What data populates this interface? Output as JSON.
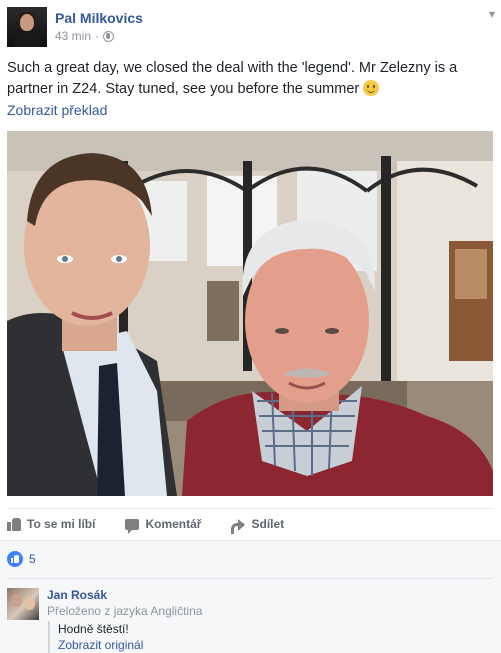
{
  "post": {
    "author": "Pal Milkovics",
    "time": "43 min",
    "separator": "·",
    "text": "Such a great day, we closed the deal with the 'legend'. Mr Zelezny is a partner in Z24. Stay tuned, see you before the summer",
    "emoji": "smile-emoji",
    "translate_link": "Zobrazit překlad"
  },
  "actions": {
    "like": "To se mi líbí",
    "comment": "Komentář",
    "share": "Sdílet"
  },
  "reactions": {
    "count": "5"
  },
  "comment": {
    "author": "Jan Rosák",
    "translation_note": "Přeloženo z jazyka Angličtina",
    "text": "Hodně štěstí!",
    "original_link": "Zobrazit originál"
  },
  "colors": {
    "link": "#365899",
    "meta": "#90949c",
    "text": "#1d2129",
    "like_blue": "#4080ff",
    "feedback_bg": "#f6f7f9"
  }
}
